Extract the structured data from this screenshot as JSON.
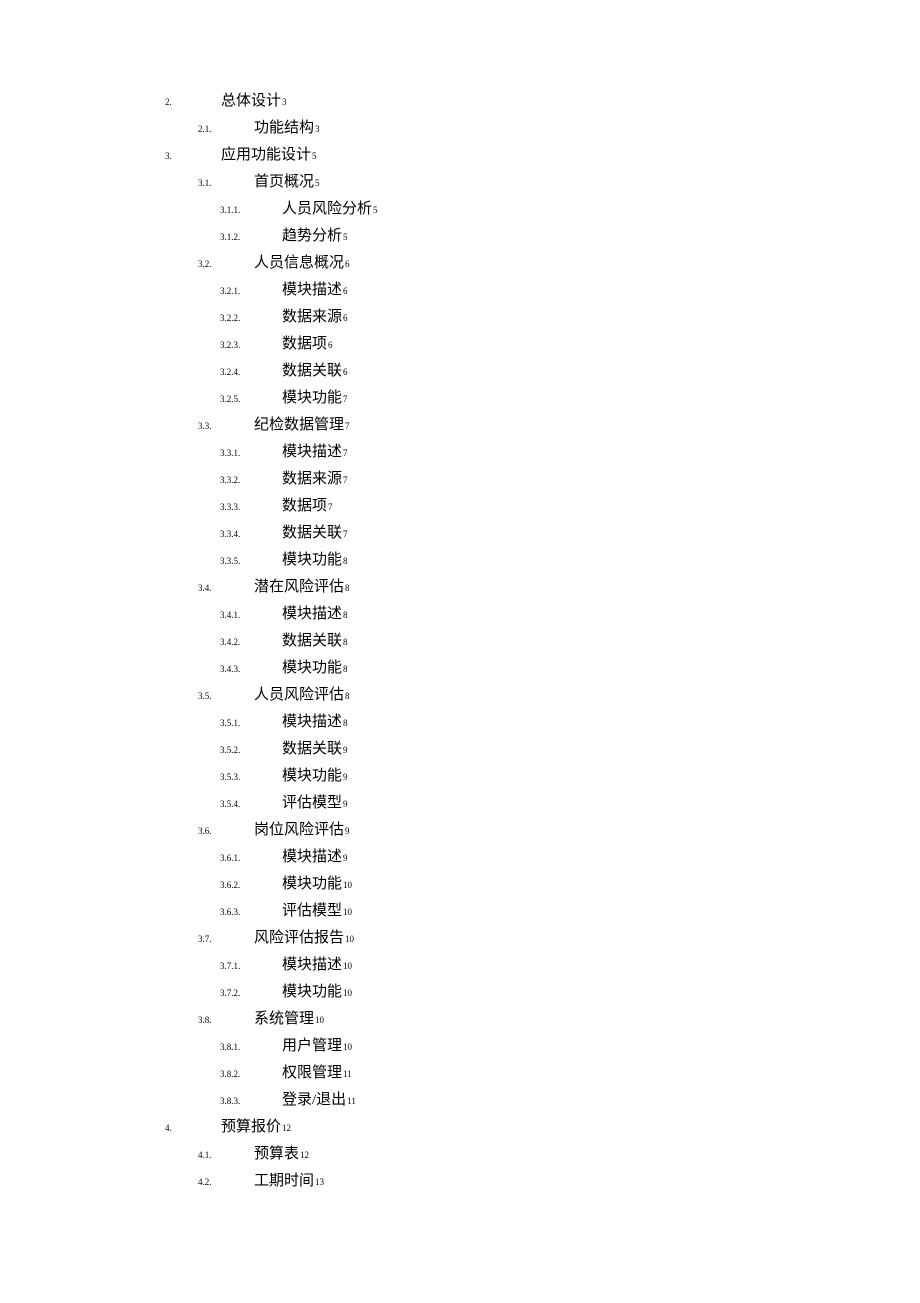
{
  "toc": [
    {
      "level": 1,
      "num": "2.",
      "title": "总体设计",
      "page": "3"
    },
    {
      "level": 2,
      "num": "2.1.",
      "title": "功能结构",
      "page": "3"
    },
    {
      "level": 1,
      "num": "3.",
      "title": "应用功能设计",
      "page": "5"
    },
    {
      "level": 2,
      "num": "3.1.",
      "title": "首页概况",
      "page": "5"
    },
    {
      "level": 3,
      "num": "3.1.1.",
      "title": "人员风险分析",
      "page": "5"
    },
    {
      "level": 3,
      "num": "3.1.2.",
      "title": "趋势分析",
      "page": "5"
    },
    {
      "level": 2,
      "num": "3.2.",
      "title": "人员信息概况",
      "page": "6"
    },
    {
      "level": 3,
      "num": "3.2.1.",
      "title": "模块描述",
      "page": "6"
    },
    {
      "level": 3,
      "num": "3.2.2.",
      "title": "数据来源",
      "page": "6"
    },
    {
      "level": 3,
      "num": "3.2.3.",
      "title": "数据项",
      "page": "6"
    },
    {
      "level": 3,
      "num": "3.2.4.",
      "title": "数据关联",
      "page": "6"
    },
    {
      "level": 3,
      "num": "3.2.5.",
      "title": "模块功能",
      "page": "7"
    },
    {
      "level": 2,
      "num": "3.3.",
      "title": "纪检数据管理",
      "page": "7"
    },
    {
      "level": 3,
      "num": "3.3.1.",
      "title": "模块描述",
      "page": "7"
    },
    {
      "level": 3,
      "num": "3.3.2.",
      "title": "数据来源",
      "page": "7"
    },
    {
      "level": 3,
      "num": "3.3.3.",
      "title": "数据项",
      "page": "7"
    },
    {
      "level": 3,
      "num": "3.3.4.",
      "title": "数据关联",
      "page": "7"
    },
    {
      "level": 3,
      "num": "3.3.5.",
      "title": "模块功能",
      "page": "8"
    },
    {
      "level": 2,
      "num": "3.4.",
      "title": "潜在风险评估",
      "page": "8"
    },
    {
      "level": 3,
      "num": "3.4.1.",
      "title": "模块描述",
      "page": "8"
    },
    {
      "level": 3,
      "num": "3.4.2.",
      "title": "数据关联",
      "page": "8"
    },
    {
      "level": 3,
      "num": "3.4.3.",
      "title": "模块功能",
      "page": "8"
    },
    {
      "level": 2,
      "num": "3.5.",
      "title": "人员风险评估",
      "page": "8"
    },
    {
      "level": 3,
      "num": "3.5.1.",
      "title": "模块描述",
      "page": "8"
    },
    {
      "level": 3,
      "num": "3.5.2.",
      "title": "数据关联",
      "page": "9"
    },
    {
      "level": 3,
      "num": "3.5.3.",
      "title": "模块功能",
      "page": "9"
    },
    {
      "level": 3,
      "num": "3.5.4.",
      "title": "评估模型",
      "page": "9"
    },
    {
      "level": 2,
      "num": "3.6.",
      "title": "岗位风险评估",
      "page": "9"
    },
    {
      "level": 3,
      "num": "3.6.1.",
      "title": "模块描述",
      "page": "9"
    },
    {
      "level": 3,
      "num": "3.6.2.",
      "title": "模块功能",
      "page": "10"
    },
    {
      "level": 3,
      "num": "3.6.3.",
      "title": "评估模型",
      "page": "10"
    },
    {
      "level": 2,
      "num": "3.7.",
      "title": "风险评估报告",
      "page": "10"
    },
    {
      "level": 3,
      "num": "3.7.1.",
      "title": "模块描述",
      "page": "10"
    },
    {
      "level": 3,
      "num": "3.7.2.",
      "title": "模块功能",
      "page": "10"
    },
    {
      "level": 2,
      "num": "3.8.",
      "title": "系统管理",
      "page": "10"
    },
    {
      "level": 3,
      "num": "3.8.1.",
      "title": "用户管理",
      "page": "10"
    },
    {
      "level": 3,
      "num": "3.8.2.",
      "title": "权限管理",
      "page": "11"
    },
    {
      "level": 3,
      "num": "3.8.3.",
      "title": "登录/退出",
      "page": "11"
    },
    {
      "level": 1,
      "num": "4.",
      "title": "预算报价",
      "page": "12"
    },
    {
      "level": 2,
      "num": "4.1.",
      "title": "预算表",
      "page": "12"
    },
    {
      "level": 2,
      "num": "4.2.",
      "title": "工期时间",
      "page": "13"
    }
  ]
}
